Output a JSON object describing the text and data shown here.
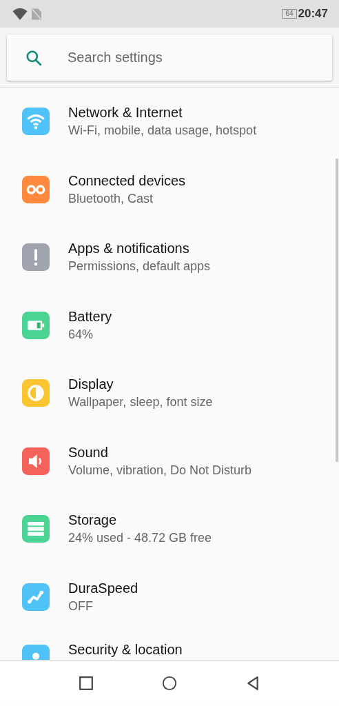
{
  "status_bar": {
    "battery": "64",
    "time": "20:47"
  },
  "search": {
    "placeholder": "Search settings"
  },
  "settings": [
    {
      "kind": "wifi",
      "color": "#4fc3f7",
      "title": "Network & Internet",
      "subtitle": "Wi-Fi, mobile, data usage, hotspot"
    },
    {
      "kind": "link",
      "color": "#ff8a3d",
      "title": "Connected devices",
      "subtitle": "Bluetooth, Cast"
    },
    {
      "kind": "alert",
      "color": "#9ea3ae",
      "title": "Apps & notifications",
      "subtitle": "Permissions, default apps"
    },
    {
      "kind": "battery",
      "color": "#4cd494",
      "title": "Battery",
      "subtitle": "64%"
    },
    {
      "kind": "display",
      "color": "#fbc531",
      "title": "Display",
      "subtitle": "Wallpaper, sleep, font size"
    },
    {
      "kind": "sound",
      "color": "#f4625a",
      "title": "Sound",
      "subtitle": "Volume, vibration, Do Not Disturb"
    },
    {
      "kind": "storage",
      "color": "#4cd494",
      "title": "Storage",
      "subtitle": "24% used - 48.72 GB free"
    },
    {
      "kind": "speed",
      "color": "#4fc3f7",
      "title": "DuraSpeed",
      "subtitle": "OFF"
    },
    {
      "kind": "security",
      "color": "#4fc3f7",
      "title": "Security & location"
    }
  ]
}
